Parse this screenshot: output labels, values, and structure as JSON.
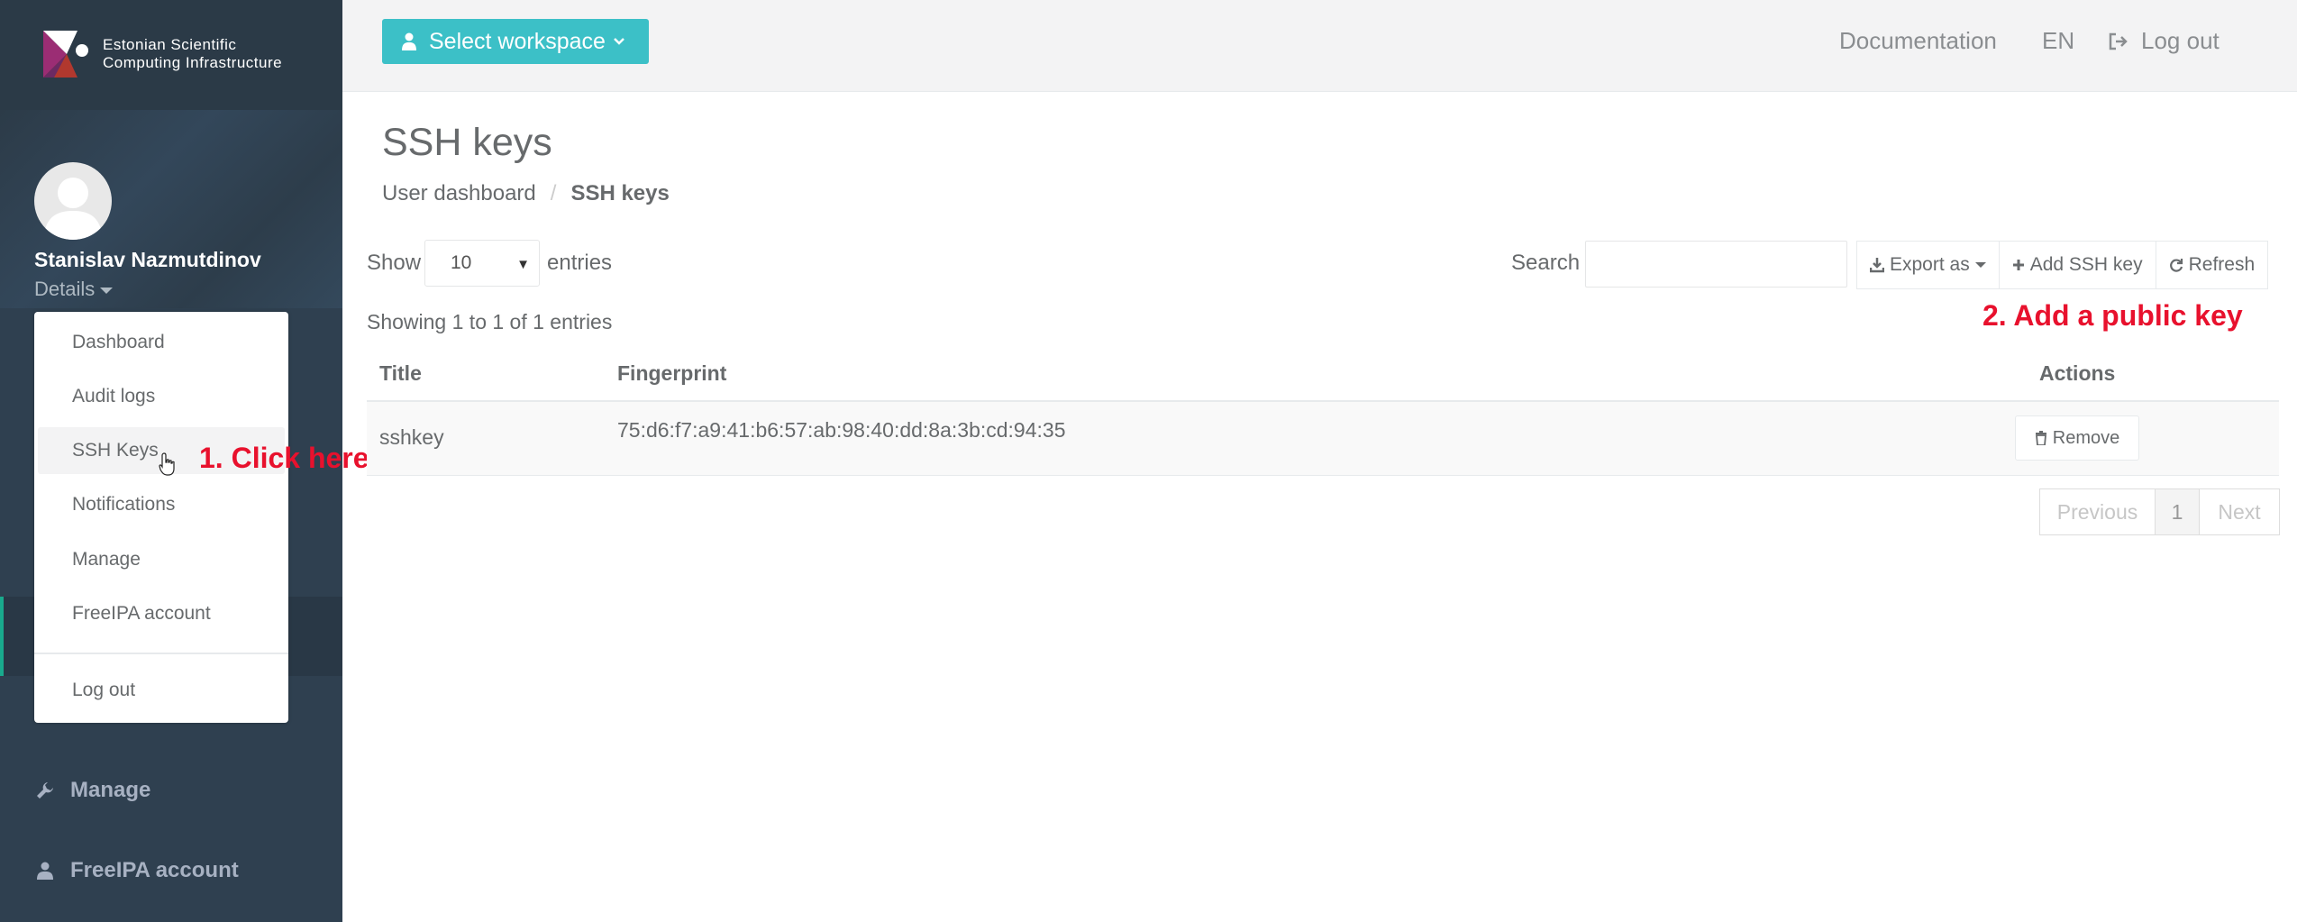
{
  "brand": {
    "line1": "Estonian Scientific",
    "line2": "Computing Infrastructure"
  },
  "user": {
    "name": "Stanislav Nazmutdinov",
    "details_label": "Details"
  },
  "user_menu": {
    "items": [
      "Dashboard",
      "Audit logs",
      "SSH Keys",
      "Notifications",
      "Manage",
      "FreeIPA account"
    ],
    "logout": "Log out"
  },
  "sidebar": {
    "items": [
      {
        "label": "Manage",
        "icon": "wrench-icon"
      },
      {
        "label": "FreeIPA account",
        "icon": "user-icon"
      }
    ]
  },
  "annotations": {
    "step1": "1. Click here",
    "step2": "2. Add a public key"
  },
  "topbar": {
    "workspace_button": "Select workspace",
    "documentation": "Documentation",
    "language": "EN",
    "logout": "Log out"
  },
  "page": {
    "title": "SSH keys",
    "breadcrumb": [
      "User dashboard",
      "SSH keys"
    ]
  },
  "table_controls": {
    "show": "Show",
    "page_size": "10",
    "entries": "entries",
    "search_label": "Search",
    "search_value": "",
    "export": "Export as",
    "add": "Add SSH key",
    "refresh": "Refresh",
    "info": "Showing 1 to 1 of 1 entries"
  },
  "table": {
    "columns": [
      "Title",
      "Fingerprint",
      "Actions"
    ],
    "rows": [
      {
        "title": "sshkey",
        "fingerprint": "75:d6:f7:a9:41:b6:57:ab:98:40:dd:8a:3b:cd:94:35",
        "action": "Remove"
      }
    ]
  },
  "pagination": {
    "previous": "Previous",
    "page": "1",
    "next": "Next"
  },
  "colors": {
    "sidebar": "#2f4050",
    "accent": "#3cc0c7",
    "annotation": "#e8112d",
    "active_strip": "#19aa8d"
  }
}
